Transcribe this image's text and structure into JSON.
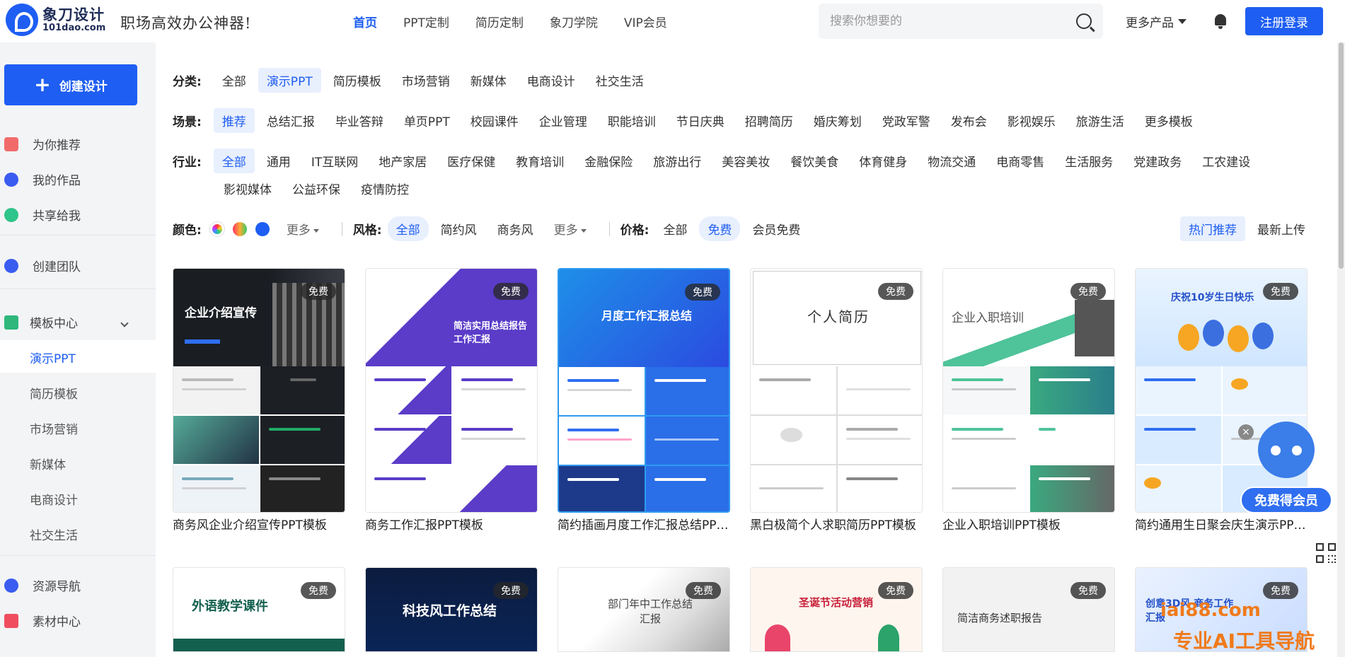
{
  "header": {
    "logo_cn": "象刀设计",
    "logo_en": "101dao.com",
    "slogan": "职场高效办公神器!",
    "nav": [
      "首页",
      "PPT定制",
      "简历定制",
      "象刀学院",
      "VIP会员"
    ],
    "search_placeholder": "搜索你想要的",
    "more_products": "更多产品",
    "login": "注册登录"
  },
  "sidebar": {
    "create": "创建设计",
    "items": [
      "为你推荐",
      "我的作品",
      "共享给我",
      "创建团队",
      "模板中心"
    ],
    "sub_items": [
      "演示PPT",
      "简历模板",
      "市场营销",
      "新媒体",
      "电商设计",
      "社交生活"
    ],
    "bottom_items": [
      "资源导航",
      "素材中心"
    ]
  },
  "filters": {
    "category_label": "分类:",
    "categories": [
      "全部",
      "演示PPT",
      "简历模板",
      "市场营销",
      "新媒体",
      "电商设计",
      "社交生活"
    ],
    "scene_label": "场景:",
    "scenes": [
      "推荐",
      "总结汇报",
      "毕业答辩",
      "单页PPT",
      "校园课件",
      "企业管理",
      "职能培训",
      "节日庆典",
      "招聘简历",
      "婚庆筹划",
      "党政军警",
      "发布会",
      "影视娱乐",
      "旅游生活",
      "更多模板"
    ],
    "industry_label": "行业:",
    "industries": [
      "全部",
      "通用",
      "IT互联网",
      "地产家居",
      "医疗保健",
      "教育培训",
      "金融保险",
      "旅游出行",
      "美容美妆",
      "餐饮美食",
      "体育健身",
      "物流交通",
      "电商零售",
      "生活服务",
      "党建政务",
      "工农建设"
    ],
    "industries_row2": [
      "影视媒体",
      "公益环保",
      "疫情防控"
    ],
    "color_label": "颜色:",
    "color_more": "更多",
    "style_label": "风格:",
    "styles": [
      "全部",
      "简约风",
      "商务风"
    ],
    "style_more": "更多",
    "price_label": "价格:",
    "prices": [
      "全部",
      "免费",
      "会员免费"
    ],
    "sort": [
      "热门推荐",
      "最新上传"
    ]
  },
  "badge_free": "免费",
  "cards": [
    {
      "title": "商务风企业介绍宣传PPT模板",
      "cover": "企业介绍宣传"
    },
    {
      "title": "商务工作汇报PPT模板",
      "cover": "简洁实用总结报告 工作汇报"
    },
    {
      "title": "简约插画月度工作汇报总结PPT模板",
      "cover": "月度工作汇报总结"
    },
    {
      "title": "黑白极简个人求职简历PPT模板",
      "cover": "个人简历"
    },
    {
      "title": "企业入职培训PPT模板",
      "cover": "企业入职培训"
    },
    {
      "title": "简约通用生日聚会庆生演示PPT模板",
      "cover": "庆祝10岁生日快乐"
    }
  ],
  "cards_row2": [
    {
      "cover": "外语教学课件"
    },
    {
      "cover": "科技风工作总结"
    },
    {
      "cover": "部门年中工作总结汇报"
    },
    {
      "cover": "圣诞节活动营销"
    },
    {
      "cover": "简洁商务述职报告"
    },
    {
      "cover": "创意3D风 商务工作汇报"
    }
  ],
  "float": {
    "vip": "免费得会员",
    "close": "×"
  },
  "watermark": {
    "line1": "iai88.com",
    "line2": "专业AI工具导航"
  }
}
